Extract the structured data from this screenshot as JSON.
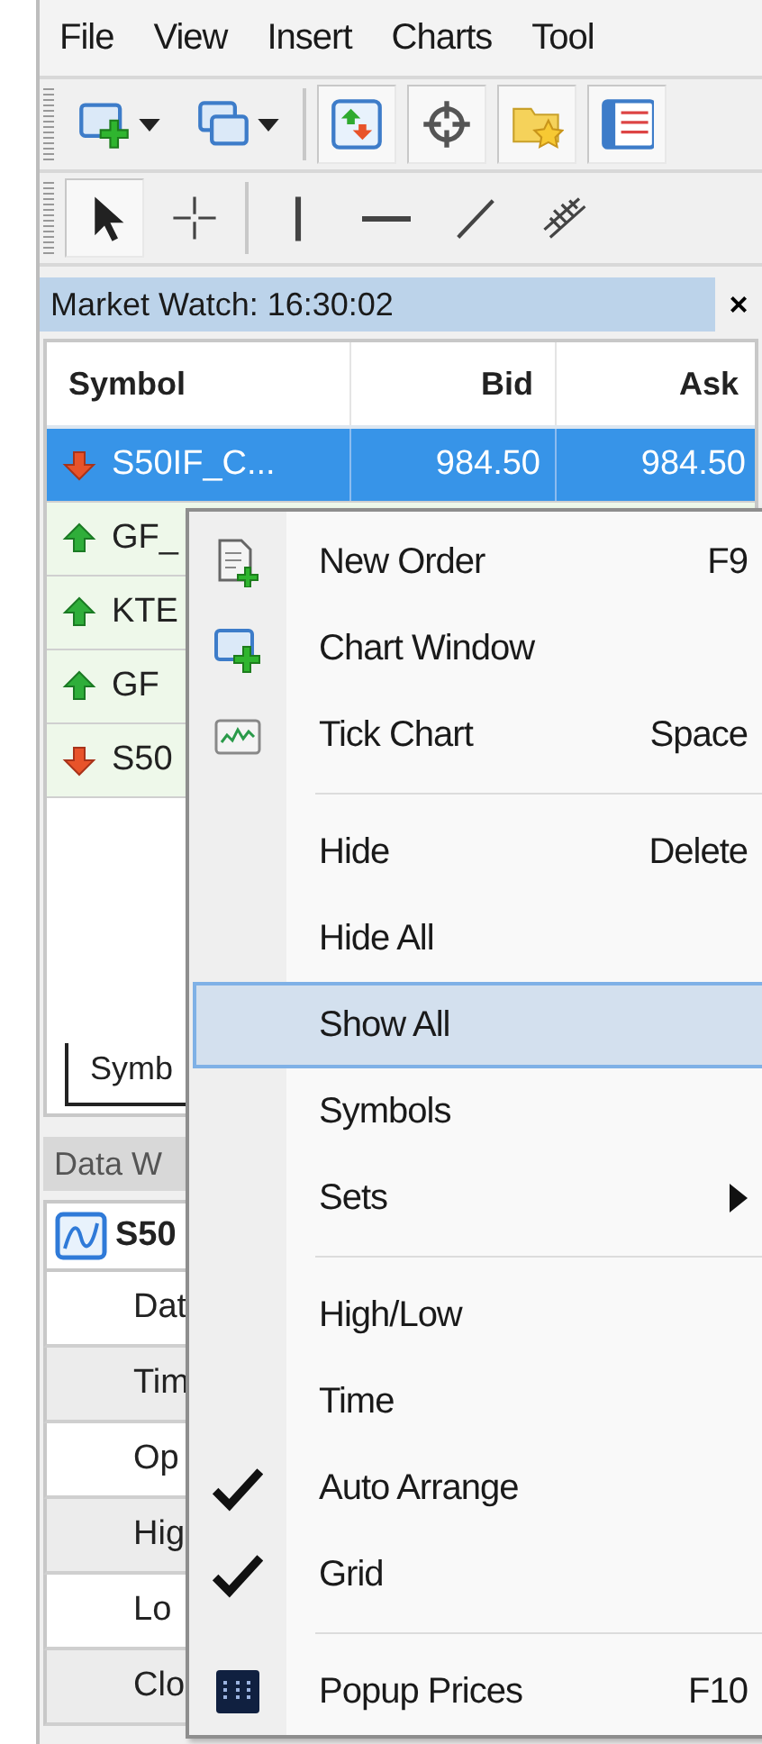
{
  "menu_bar": [
    "File",
    "View",
    "Insert",
    "Charts",
    "Tool"
  ],
  "toolbars": [
    {
      "buttons": [
        {
          "pressed": false,
          "dropdown": true
        },
        {
          "pressed": false,
          "dropdown": true
        },
        {
          "pressed": true,
          "dropdown": false
        },
        {
          "pressed": true,
          "dropdown": false
        },
        {
          "pressed": true,
          "dropdown": false
        },
        {
          "pressed": true,
          "dropdown": false
        }
      ]
    },
    {
      "buttons": [
        {
          "pressed": true,
          "dropdown": false
        },
        {
          "pressed": false,
          "dropdown": false
        },
        {
          "pressed": false,
          "dropdown": false
        },
        {
          "pressed": false,
          "dropdown": false
        },
        {
          "pressed": false,
          "dropdown": false
        },
        {
          "pressed": false,
          "dropdown": false
        }
      ]
    }
  ],
  "market_watch": {
    "title": "Market Watch: 16:30:02",
    "active": true,
    "close": "×",
    "columns": [
      "Symbol",
      "Bid",
      "Ask"
    ],
    "rows": [
      {
        "symbol": "S50IF_C...",
        "bid": "984.50",
        "ask": "984.50",
        "rising": false,
        "selected": true
      },
      {
        "symbol": "GF_",
        "rising": true,
        "selected": false
      },
      {
        "symbol": "KTE",
        "rising": true,
        "selected": false
      },
      {
        "symbol": "GF",
        "rising": true,
        "selected": false
      },
      {
        "symbol": "S50",
        "rising": false,
        "selected": false
      }
    ],
    "tabs": [
      {
        "label": "Symb",
        "selected": true
      }
    ]
  },
  "data_window": {
    "title": "Data W",
    "active": false,
    "symbol": "S50",
    "rows": [
      "Dat",
      "Tim",
      "Op",
      "Hig",
      "Lo",
      "Clo"
    ]
  },
  "context_menu": [
    {
      "kind": "item",
      "label": "New Order",
      "shortcut": "F9",
      "checked": false,
      "selected": false
    },
    {
      "kind": "item",
      "label": "Chart Window",
      "checked": false,
      "selected": false
    },
    {
      "kind": "item",
      "label": "Tick Chart",
      "shortcut": "Space",
      "checked": false,
      "selected": false
    },
    {
      "kind": "separator"
    },
    {
      "kind": "item",
      "label": "Hide",
      "shortcut": "Delete",
      "checked": false,
      "selected": false
    },
    {
      "kind": "item",
      "label": "Hide All",
      "checked": false,
      "selected": false
    },
    {
      "kind": "item",
      "label": "Show All",
      "checked": false,
      "selected": true
    },
    {
      "kind": "item",
      "label": "Symbols",
      "checked": false,
      "selected": false
    },
    {
      "kind": "item",
      "label": "Sets",
      "submenu": true,
      "checked": false,
      "selected": false
    },
    {
      "kind": "separator"
    },
    {
      "kind": "item",
      "label": "High/Low",
      "checked": false,
      "selected": false
    },
    {
      "kind": "item",
      "label": "Time",
      "checked": false,
      "selected": false
    },
    {
      "kind": "item",
      "label": "Auto Arrange",
      "checked": true,
      "selected": false
    },
    {
      "kind": "item",
      "label": "Grid",
      "checked": true,
      "selected": false
    },
    {
      "kind": "separator"
    },
    {
      "kind": "item",
      "label": "Popup Prices",
      "shortcut": "F10",
      "checked": false,
      "selected": false
    }
  ]
}
